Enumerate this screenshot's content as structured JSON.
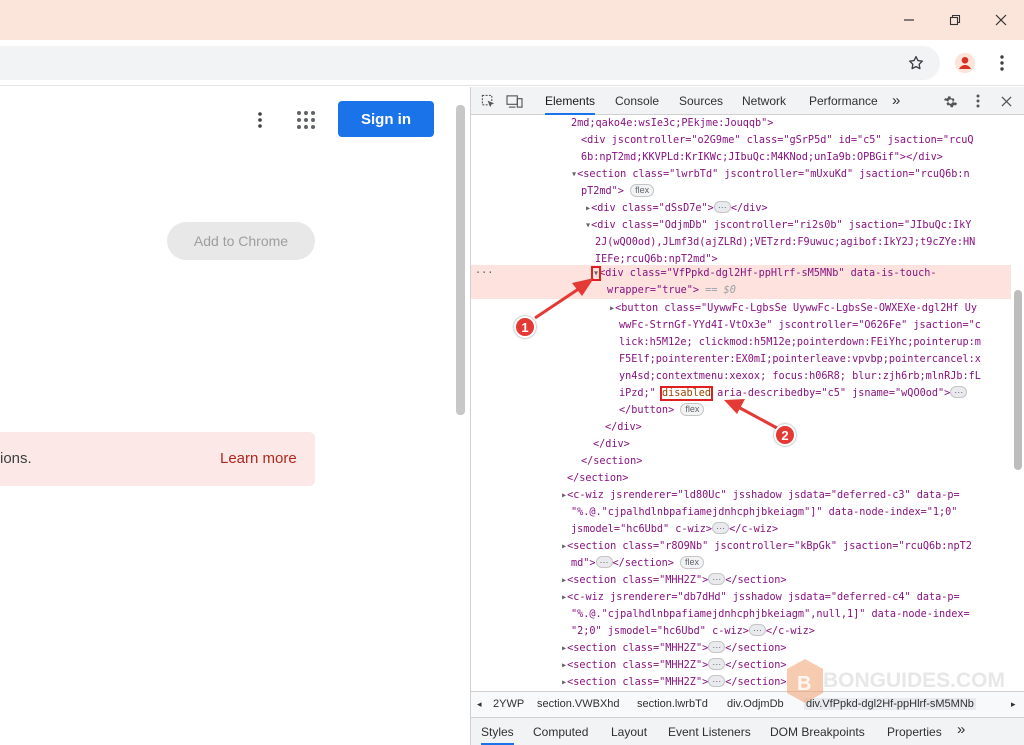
{
  "window": {
    "minimize_icon": "minimize-icon",
    "restore_icon": "restore-icon",
    "close_icon": "close-icon"
  },
  "toolbar": {
    "bookmark_icon": "star-icon",
    "profile_icon": "profile-icon",
    "menu_icon": "kebab-icon"
  },
  "page": {
    "signin_label": "Sign in",
    "add_to_chrome_label": "Add to Chrome",
    "banner_text": "ions.",
    "banner_link": "Learn more"
  },
  "devtools": {
    "tabs": [
      "Elements",
      "Console",
      "Sources",
      "Network",
      "Performance"
    ],
    "more_tabs": "»",
    "lines": [
      "2md;qako4e:wsIe3c;PEkjme:Jouqqb\">",
      "<div jscontroller=\"o2G9me\" class=\"gSrP5d\" id=\"c5\" jsaction=\"rcuQ",
      "6b:npT2md;KKVPLd:KrIKWc;JIbuQc:M4KNod;unIa9b:OPBGif\"></div>",
      "<section class=\"lwrbTd\" jscontroller=\"mUxuKd\" jsaction=\"rcuQ6b:n",
      "pT2md\">",
      "<div class=\"dSsD7e\">",
      "</div>",
      "<div class=\"OdjmDb\" jscontroller=\"ri2s0b\" jsaction=\"JIbuQc:IkY",
      "2J(wQO0od),JLmf3d(ajZLRd);VETzrd:F9uwuc;agibof:IkY2J;t9cZYe:HN",
      "IEFe;rcuQ6b:npT2md\">",
      "<div class=\"VfPpkd-dgl2Hf-ppHlrf-sM5MNb\" data-is-touch-",
      "wrapper=\"true\">",
      "== $0",
      "<button class=\"UywwFc-LgbsSe UywwFc-LgbsSe-OWXEXe-dgl2Hf Uy",
      "wwFc-StrnGf-YYd4I-VtOx3e\" jscontroller=\"O626Fe\" jsaction=\"c",
      "lick:h5M12e; clickmod:h5M12e;pointerdown:FEiYhc;pointerup:m",
      "F5Elf;pointerenter:EX0mI;pointerleave:vpvbp;pointercancel:x",
      "yn4sd;contextmenu:xexox; focus:h06R8; blur:zjh6rb;mlnRJb:fL",
      "iPzd;\"",
      "disabled",
      "aria-describedby=\"c5\" jsname=\"wQO0od\">",
      "</button>",
      "</div>",
      "</div>",
      "</section>",
      "</section>",
      "<c-wiz jsrenderer=\"ld80Uc\" jsshadow jsdata=\"deferred-c3\" data-p=",
      "\"%.@.\"cjpalhdlnbpafiamejdnhcphjbkeiagm\"]\" data-node-index=\"1;0\"",
      "jsmodel=\"hc6Ubd\" c-wiz>",
      "</c-wiz>",
      "<section class=\"r8O9Nb\" jscontroller=\"kBpGk\" jsaction=\"rcuQ6b:npT2",
      "md\">",
      "</section>",
      "<section class=\"MHH2Z\">",
      "</section>",
      "<c-wiz jsrenderer=\"db7dHd\" jsshadow jsdata=\"deferred-c4\" data-p=",
      "\"%.@.\"cjpalhdlnbpafiamejdnhcphjbkeiagm\",null,1]\" data-node-index=",
      "\"2;0\" jsmodel=\"hc6Ubd\" c-wiz>",
      "</c-wiz>",
      "<section class=\"MHH2Z\">",
      "</section>",
      "<section class=\"MHH2Z\">",
      "</section>",
      "<section class=\"MHH2Z\">",
      "</section>"
    ],
    "badge_flex": "flex",
    "ellipsis": "···",
    "row_dots": "···",
    "breadcrumbs": [
      "2YWP",
      "section.VWBXhd",
      "section.lwrbTd",
      "div.OdjmDb",
      "div.VfPpkd-dgl2Hf-ppHlrf-sM5MNb"
    ],
    "bottom_tabs": [
      "Styles",
      "Computed",
      "Layout",
      "Event Listeners",
      "DOM Breakpoints",
      "Properties"
    ],
    "bottom_more": "»"
  },
  "annotations": {
    "badge1": "1",
    "badge2": "2"
  },
  "watermark": "BONGUIDES.COM",
  "colors": {
    "accent": "#1a73e8",
    "annotation": "#e53935",
    "titlebar": "#fbe4da"
  }
}
